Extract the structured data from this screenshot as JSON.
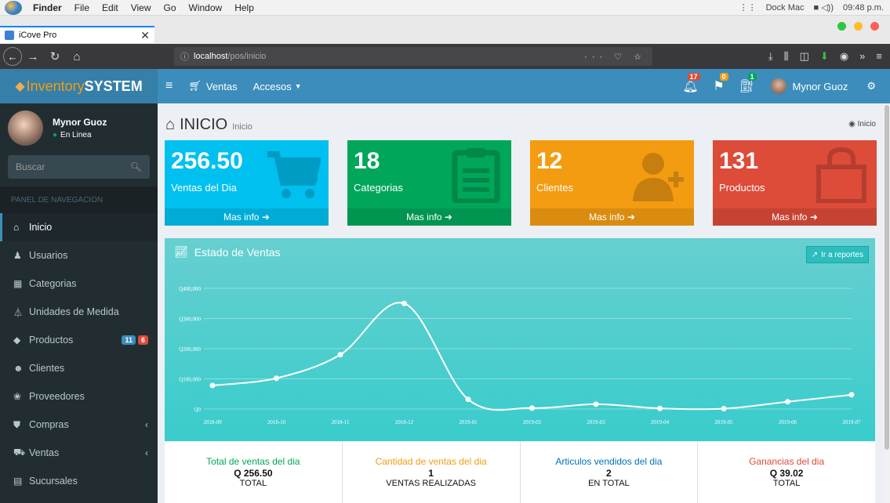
{
  "menubar": {
    "app": "Finder",
    "items": [
      "File",
      "Edit",
      "View",
      "Go",
      "Window",
      "Help"
    ],
    "right": {
      "dock": "Dock Mac",
      "clock": "09:48 p.m."
    }
  },
  "browser": {
    "tab_title": "iCove Pro",
    "url_host": "localhost",
    "url_path": "/pos/inicio",
    "url_actions": "··· ♡ ☆"
  },
  "header": {
    "brand_part1": "Inventory",
    "brand_part2": "SYSTEM",
    "menu_ventas": "Ventas",
    "menu_accesos": "Accesos",
    "notif_bell_count": "17",
    "notif_flag_count": "0",
    "notif_bag_count": "1",
    "user_name": "Mynor Guoz"
  },
  "sidebar": {
    "user_name": "Mynor Guoz",
    "status": "En Linea",
    "search_placeholder": "Buscar",
    "nav_header": "PANEL DE NAVEGACION",
    "items": [
      {
        "label": "Inicio"
      },
      {
        "label": "Usuarios"
      },
      {
        "label": "Categorias"
      },
      {
        "label": "Unidades de Medida"
      },
      {
        "label": "Productos",
        "badge1": "11",
        "badge2": "6"
      },
      {
        "label": "Clientes"
      },
      {
        "label": "Proveedores"
      },
      {
        "label": "Compras"
      },
      {
        "label": "Ventas"
      },
      {
        "label": "Sucursales"
      }
    ]
  },
  "content": {
    "title": "INICIO",
    "subtitle": "Inicio",
    "breadcrumb": "Inicio",
    "boxes": [
      {
        "value": "256.50",
        "label": "Ventas del Dia",
        "more": "Mas info",
        "color": "#00c0ef"
      },
      {
        "value": "18",
        "label": "Categorias",
        "more": "Mas info",
        "color": "#00a65a"
      },
      {
        "value": "12",
        "label": "Clientes",
        "more": "Mas info",
        "color": "#f39c12"
      },
      {
        "value": "131",
        "label": "Productos",
        "more": "Mas info",
        "color": "#dd4b39"
      }
    ],
    "chart_title": "Estado de Ventas",
    "report_button": "Ir a reportes",
    "stats": [
      {
        "title": "Total de ventas del dia",
        "value": "Q 256.50",
        "unit": "TOTAL",
        "color": "#00a65a"
      },
      {
        "title": "Cantidad de ventas del dia",
        "value": "1",
        "unit": "VENTAS REALIZADAS",
        "color": "#f39c12"
      },
      {
        "title": "Articulos vendidos del dia",
        "value": "2",
        "unit": "EN TOTAL",
        "color": "#0073b7"
      },
      {
        "title": "Ganancias del dia",
        "value": "Q 39.02",
        "unit": "TOTAL",
        "color": "#dd4b39"
      }
    ]
  },
  "chart_data": {
    "type": "line",
    "title": "Estado de Ventas",
    "x": [
      "2018-09",
      "2018-10",
      "2018-11",
      "2018-12",
      "2019-01",
      "2019-02",
      "2019-03",
      "2019-04",
      "2019-05",
      "2019-06",
      "2019-07"
    ],
    "series": [
      {
        "values": [
          78000,
          102000,
          180000,
          350000,
          32000,
          3000,
          16000,
          2000,
          1000,
          24000,
          47000
        ]
      }
    ],
    "yticks": [
      "Q0",
      "Q100,000",
      "Q200,000",
      "Q300,000",
      "Q400,000"
    ],
    "ylim": [
      0,
      400000
    ],
    "grid": true
  }
}
